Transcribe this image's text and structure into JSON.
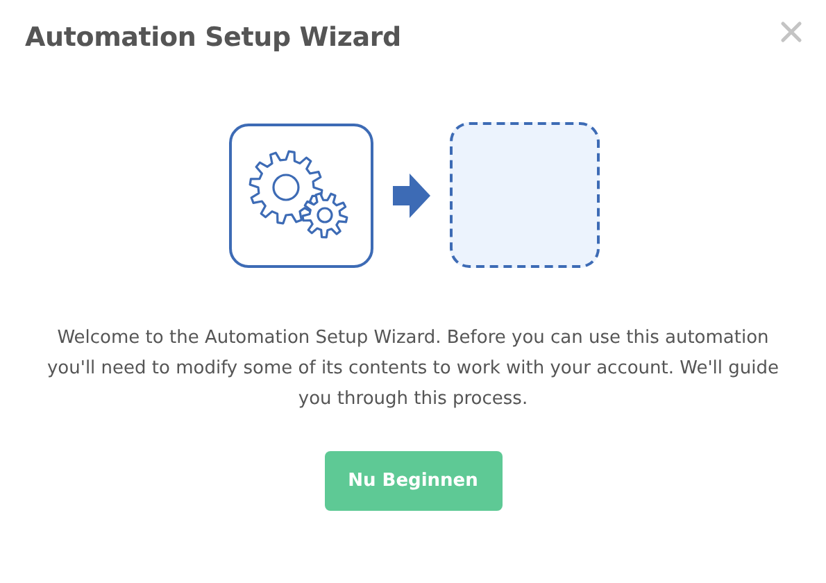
{
  "dialog": {
    "title": "Automation Setup Wizard"
  },
  "message": "Welcome to the Automation Setup Wizard. Before you can use this automation you'll need to modify some of its contents to work with your account. We'll guide you through this process.",
  "buttons": [
    {
      "label": "Nu Beginnen",
      "kind": "primary"
    }
  ]
}
